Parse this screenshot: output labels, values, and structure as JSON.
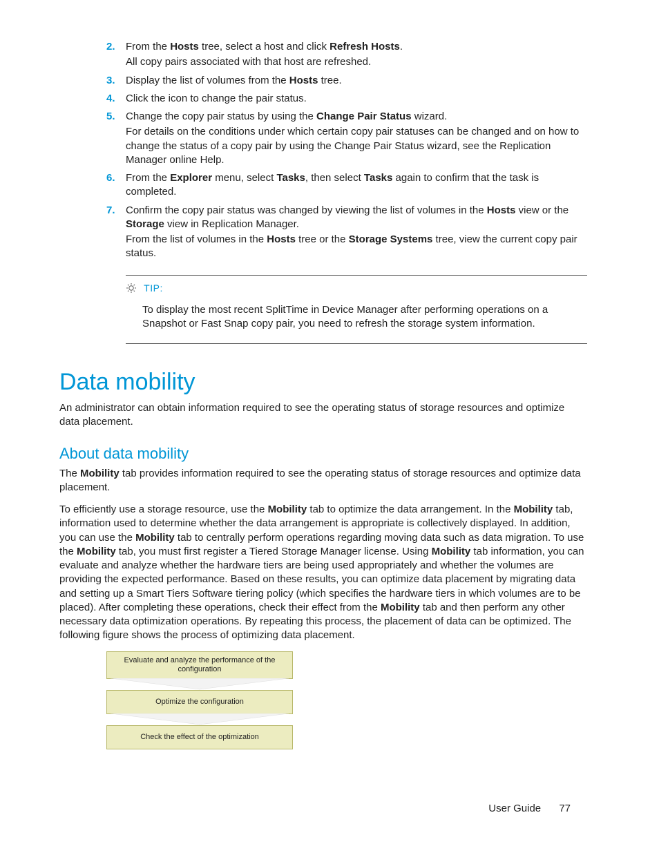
{
  "steps": {
    "s2": {
      "num": "2.",
      "pre": "From the ",
      "b1": "Hosts",
      "mid": " tree, select a host and click ",
      "b2": "Refresh Hosts",
      "post": ".",
      "after": "All copy pairs associated with that host are refreshed."
    },
    "s3": {
      "num": "3.",
      "pre": "Display the list of volumes from the ",
      "b1": "Hosts",
      "post": " tree."
    },
    "s4": {
      "num": "4.",
      "text": "Click the icon to change the pair status."
    },
    "s5": {
      "num": "5.",
      "pre": "Change the copy pair status by using the ",
      "b1": "Change Pair Status",
      "post": " wizard.",
      "after": "For details on the conditions under which certain copy pair statuses can be changed and on how to change the status of a copy pair by using the Change Pair Status wizard, see the Replication Manager online Help."
    },
    "s6": {
      "num": "6.",
      "pre": "From the ",
      "b1": "Explorer",
      "mid1": " menu, select ",
      "b2": "Tasks",
      "mid2": ", then select ",
      "b3": "Tasks",
      "post": " again to confirm that the task is completed."
    },
    "s7": {
      "num": "7.",
      "pre": "Confirm the copy pair status was changed by viewing the list of volumes in the ",
      "b1": "Hosts",
      "mid": " view or the ",
      "b2": "Storage",
      "post": " view in Replication Manager.",
      "after_pre": "From the list of volumes in the ",
      "after_b1": "Hosts",
      "after_mid": " tree or the ",
      "after_b2": "Storage Systems",
      "after_post": " tree, view the current copy pair status."
    }
  },
  "tip": {
    "label": "TIP:",
    "body": "To display the most recent SplitTime in Device Manager after performing operations on a Snapshot or Fast Snap copy pair, you need to refresh the storage system information."
  },
  "h1": "Data mobility",
  "intro": "An administrator can obtain information required to see the operating status of storage resources and optimize data placement.",
  "h2": "About data mobility",
  "about": {
    "p1_pre": "The ",
    "p1_b1": "Mobility",
    "p1_post": " tab provides information required to see the operating status of storage resources and optimize data placement.",
    "p2_a": "To efficiently use a storage resource, use the ",
    "p2_b1": "Mobility",
    "p2_b": " tab to optimize the data arrangement. In the ",
    "p2_b2": "Mobility",
    "p2_c": " tab, information used to determine whether the data arrangement is appropriate is collectively displayed. In addition, you can use the ",
    "p2_b3": "Mobility",
    "p2_d": " tab to centrally perform operations regarding moving data such as data migration. To use the ",
    "p2_b4": "Mobility",
    "p2_e": " tab, you must first register a Tiered Storage Manager license. Using ",
    "p2_b5": "Mobility",
    "p2_f": " tab information, you can evaluate and analyze whether the hardware tiers are being used appropriately and whether the volumes are providing the expected performance. Based on these results, you can optimize data placement by migrating data and setting up a Smart Tiers Software tiering policy (which specifies the hardware tiers in which volumes are to be placed). After completing these operations, check their effect from the ",
    "p2_b6": "Mobility",
    "p2_g": " tab and then perform any other necessary data optimization operations. By repeating this process, the placement of data can be optimized. The following figure shows the process of optimizing data placement."
  },
  "flow": {
    "s1": "Evaluate and analyze the performance of the configuration",
    "s2": "Optimize the configuration",
    "s3": "Check the effect of the optimization"
  },
  "footer": {
    "label": "User Guide",
    "page": "77"
  }
}
